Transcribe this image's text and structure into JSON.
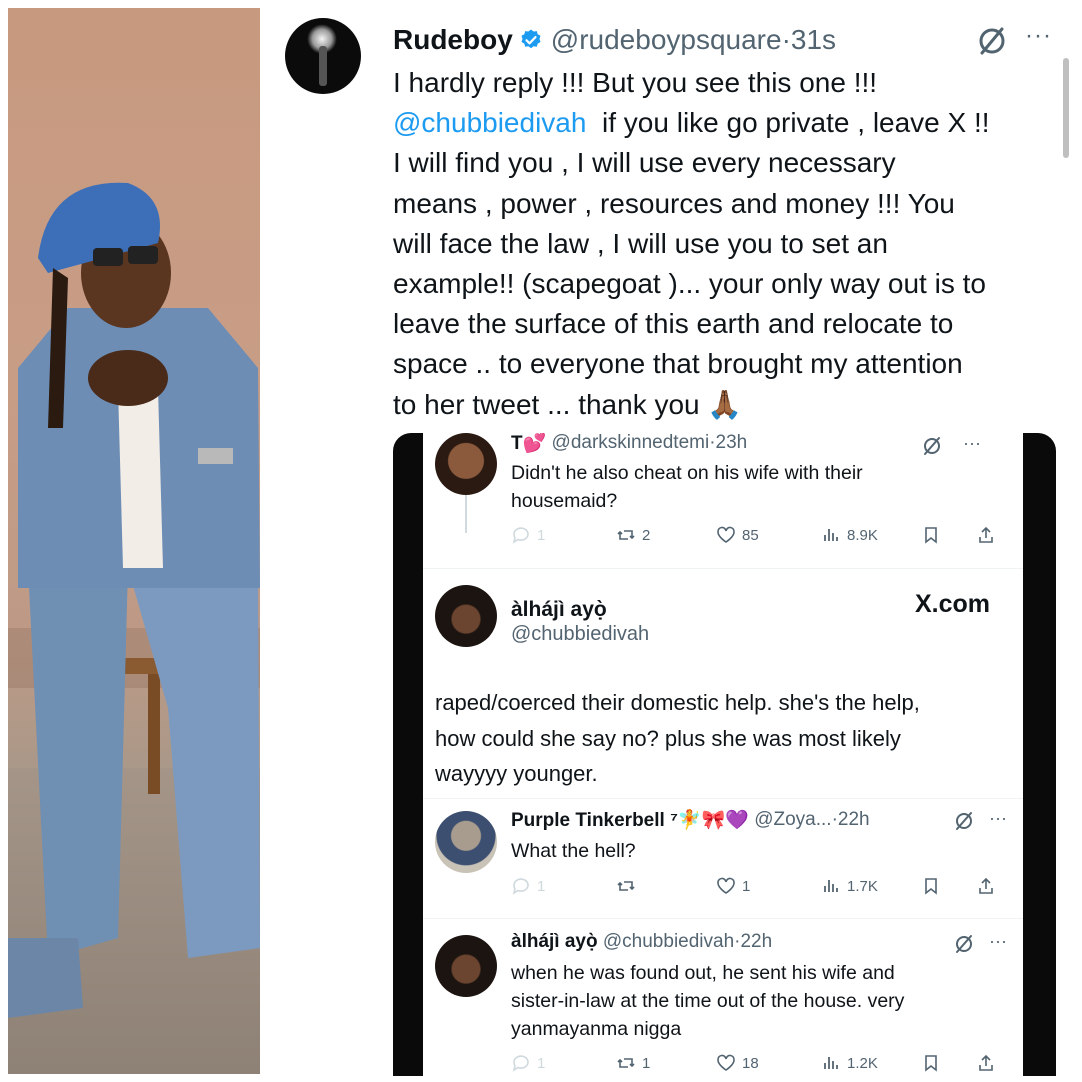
{
  "main_tweet": {
    "display_name": "Rudeboy",
    "handle": "@rudeboypsquare",
    "dot": "·",
    "time": "31s",
    "more": "···",
    "text_lines": [
      "I hardly reply !!! But you see this one !!!",
      "if you like go private , leave X !!",
      "I will find you , I will use every necessary",
      "means , power , resources and money !!!  You",
      "will face the law , I will use you to set an",
      "example!! (scapegoat )... your only way out is to",
      "leave the surface of this earth and relocate to",
      "space .. to everyone that brought my attention",
      "to her tweet ... thank you 🙏🏾"
    ],
    "mention": "@chubbiedivah"
  },
  "embedded": {
    "reply1": {
      "name": "T💕",
      "handle": "@darkskinnedtemi",
      "dot": "·",
      "time": "23h",
      "more": "···",
      "text_lines": [
        "Didn't he also cheat on his wife with their",
        "housemaid?"
      ],
      "replies": "1",
      "retweets": "2",
      "likes": "85",
      "views": "8.9K"
    },
    "quote": {
      "name": "àlhájì ayọ̀",
      "handle": "@chubbiedivah",
      "watermark": "X.com",
      "text_lines": [
        "raped/coerced their domestic help. she's the help,",
        "how could she say no? plus she was most likely",
        "wayyyy younger."
      ]
    },
    "reply2": {
      "name": "Purple Tinkerbell ⁷🧚🎀💜",
      "handle": "@Zoya...",
      "dot": "·",
      "time": "22h",
      "more": "···",
      "text": "What the hell?",
      "replies": "1",
      "retweets": "",
      "likes": "1",
      "views": "1.7K"
    },
    "reply3": {
      "name": "àlhájì ayọ̀",
      "handle": "@chubbiedivah",
      "dot": "·",
      "time": "22h",
      "more": "···",
      "text_lines": [
        "when he was found out, he sent his wife and",
        "sister-in-law at the time out of the house.  very",
        "yanmayanma nigga"
      ],
      "replies": "1",
      "retweets": "1",
      "likes": "18",
      "views": "1.2K"
    }
  },
  "colors": {
    "accent": "#1d9bf0",
    "text": "#0f1419",
    "secondary": "#536471"
  },
  "icons": [
    "verified-badge-icon",
    "grok-icon",
    "more-icon",
    "reply-icon",
    "retweet-icon",
    "like-icon",
    "views-icon",
    "bookmark-icon",
    "share-icon"
  ]
}
